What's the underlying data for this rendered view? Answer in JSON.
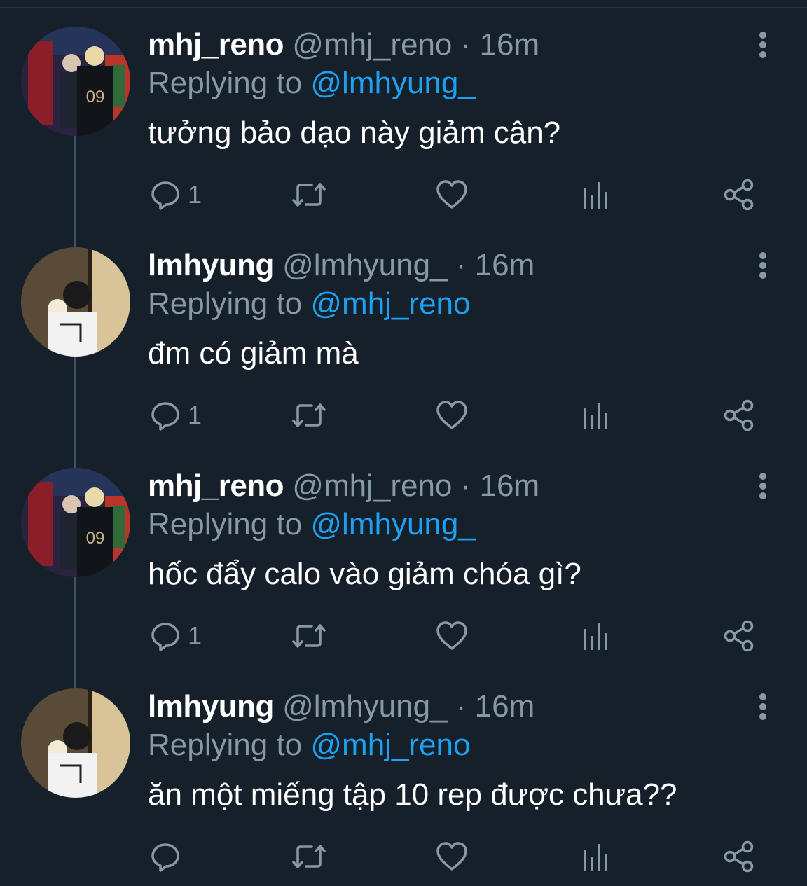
{
  "tweets": [
    {
      "name": "mhj_reno",
      "handle": "@mhj_reno",
      "separator": "·",
      "time": "16m",
      "replying_label": "Replying to",
      "replying_to": "@lmhyung_",
      "text": "tưởng bảo dạo này giảm cân?",
      "reply_count": "1",
      "avatar": "avatar-mhj-reno"
    },
    {
      "name": "lmhyung",
      "handle": "@lmhyung_",
      "separator": "·",
      "time": "16m",
      "replying_label": "Replying to",
      "replying_to": "@mhj_reno",
      "text": "đm có giảm mà",
      "reply_count": "1",
      "avatar": "avatar-lmhyung"
    },
    {
      "name": "mhj_reno",
      "handle": "@mhj_reno",
      "separator": "·",
      "time": "16m",
      "replying_label": "Replying to",
      "replying_to": "@lmhyung_",
      "text": "hốc đẩy calo vào giảm chóa gì?",
      "reply_count": "1",
      "avatar": "avatar-mhj-reno"
    },
    {
      "name": "lmhyung",
      "handle": "@lmhyung_",
      "separator": "·",
      "time": "16m",
      "replying_label": "Replying to",
      "replying_to": "@mhj_reno",
      "text": "ăn một miếng tập 10 rep được chưa??",
      "reply_count": "",
      "avatar": "avatar-lmhyung"
    }
  ],
  "icons": [
    "reply-icon",
    "retweet-icon",
    "like-icon",
    "analytics-icon",
    "share-icon",
    "more-options-icon"
  ],
  "colors": {
    "background": "#15202b",
    "text": "#ffffff",
    "muted": "#8899a6",
    "link": "#1da1f2",
    "thread_line": "#3d5466"
  }
}
